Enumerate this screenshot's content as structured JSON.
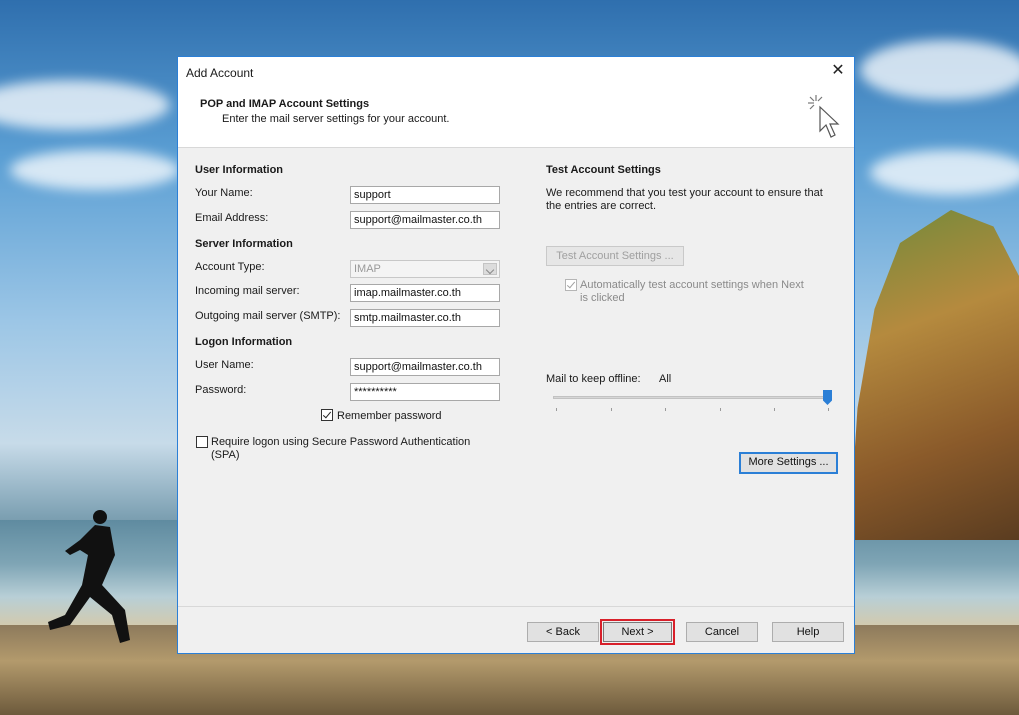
{
  "dialog": {
    "title": "Add Account",
    "header_title": "POP and IMAP Account Settings",
    "header_subtitle": "Enter the mail server settings for your account."
  },
  "user_info": {
    "heading": "User Information",
    "your_name_label": "Your Name:",
    "your_name_value": "support",
    "email_label": "Email Address:",
    "email_value": "support@mailmaster.co.th"
  },
  "server_info": {
    "heading": "Server Information",
    "account_type_label": "Account Type:",
    "account_type_value": "IMAP",
    "incoming_label": "Incoming mail server:",
    "incoming_value": "imap.mailmaster.co.th",
    "outgoing_label": "Outgoing mail server (SMTP):",
    "outgoing_value": "smtp.mailmaster.co.th"
  },
  "logon_info": {
    "heading": "Logon Information",
    "username_label": "User Name:",
    "username_value": "support@mailmaster.co.th",
    "password_label": "Password:",
    "password_value": "**********",
    "remember_label": "Remember password",
    "remember_checked": true,
    "spa_label_line1": "Require logon using Secure Password Authentication",
    "spa_label_line2": "(SPA)",
    "spa_checked": false
  },
  "test_settings": {
    "heading": "Test Account Settings",
    "desc_line1": "We recommend that you test your account to ensure that",
    "desc_line2": "the entries are correct.",
    "test_button": "Test Account Settings ...",
    "auto_test_line1": "Automatically test account settings when Next",
    "auto_test_line2": "is clicked",
    "auto_test_checked": true
  },
  "offline": {
    "label": "Mail to keep offline:",
    "value": "All",
    "slider_level": 1.0
  },
  "more_settings_button": "More Settings ...",
  "footer": {
    "back": "< Back",
    "next": "Next >",
    "cancel": "Cancel",
    "help": "Help"
  },
  "colors": {
    "accent": "#2b7fd6",
    "highlight": "#d8202a"
  }
}
